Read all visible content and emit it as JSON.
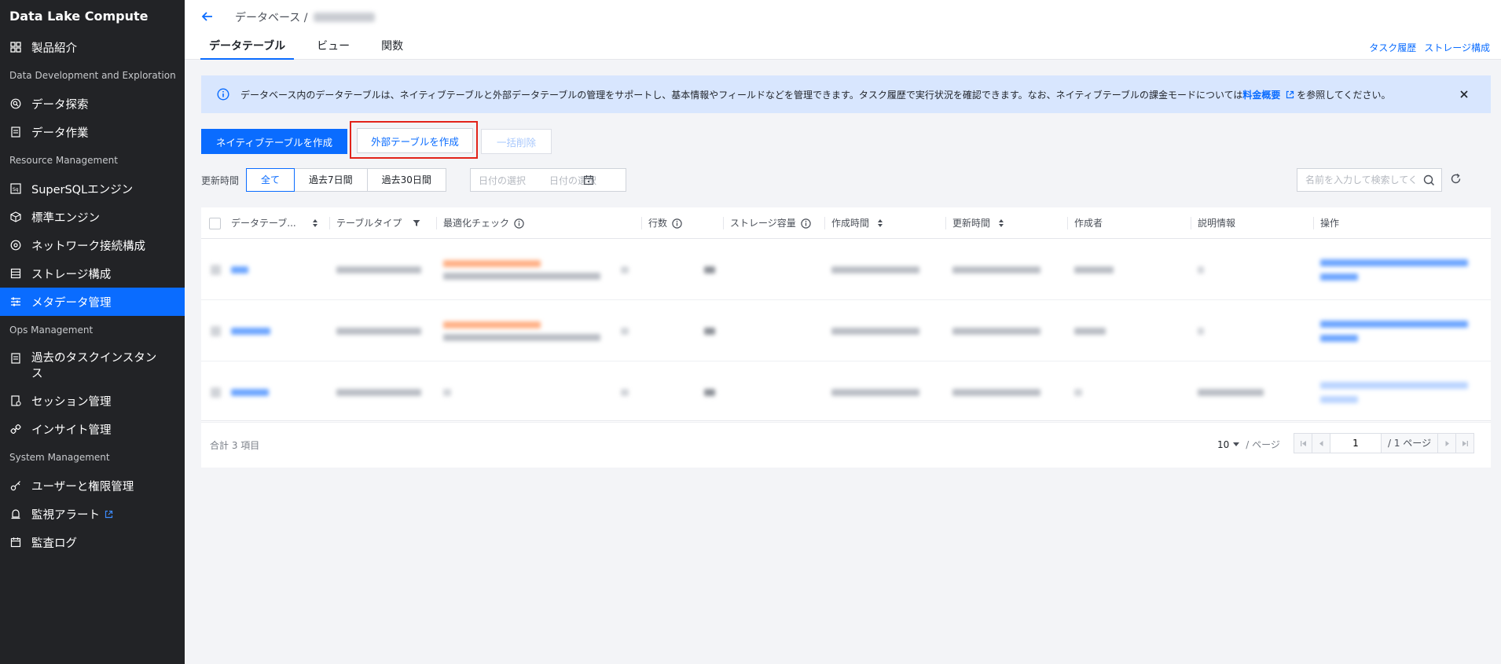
{
  "sidebar": {
    "brand": "Data Lake Compute",
    "product_intro": "製品紹介",
    "group_dev": "Data Development and Exploration",
    "data_explore": "データ探索",
    "data_job": "データ作業",
    "group_resource": "Resource Management",
    "supersql": "SuperSQLエンジン",
    "std_engine": "標準エンジン",
    "network": "ネットワーク接続構成",
    "storage": "ストレージ構成",
    "metadata": "メタデータ管理",
    "group_ops": "Ops Management",
    "task_history": "過去のタスクインスタンス",
    "session": "セッション管理",
    "insight": "インサイト管理",
    "group_system": "System Management",
    "users": "ユーザーと権限管理",
    "monitor": "監視アラート",
    "audit": "監査ログ"
  },
  "header": {
    "breadcrumb": "データベース /",
    "tabs": [
      "データテーブル",
      "ビュー",
      "関数"
    ],
    "link_task_history": "タスク履歴",
    "link_storage": "ストレージ構成"
  },
  "alert": {
    "text": "データベース内のデータテーブルは、ネイティブテーブルと外部データテーブルの管理をサポートし、基本情報やフィールドなどを管理できます。タスク履歴で実行状況を確認できます。なお、ネイティブテーブルの課金モードについては",
    "link": "料金概要",
    "text_after": "を参照してください。"
  },
  "actions": {
    "create_native": "ネイティブテーブルを作成",
    "create_external": "外部テーブルを作成",
    "bulk_delete": "一括削除"
  },
  "filters": {
    "label": "更新時間",
    "options": [
      "全て",
      "過去7日間",
      "過去30日間"
    ],
    "selected": "全て",
    "date_start": "日付の選択",
    "date_end": "日付の選択",
    "search_placeholder": "名前を入力して検索してく"
  },
  "table": {
    "columns": [
      "データテーブ...",
      "テーブルタイプ",
      "最適化チェック",
      "行数",
      "ストレージ容量",
      "作成時間",
      "更新時間",
      "作成者",
      "説明情報",
      "操作"
    ]
  },
  "footer": {
    "total": "合計 3 項目",
    "page_size": "10",
    "page_unit": "/ ページ",
    "page": "1",
    "page_total": "/ 1 ページ"
  },
  "colors": {
    "primary": "#0a6cff",
    "sidebar_bg": "#222326",
    "alert_bg": "#d8e6fe",
    "highlight": "#e2231a"
  }
}
